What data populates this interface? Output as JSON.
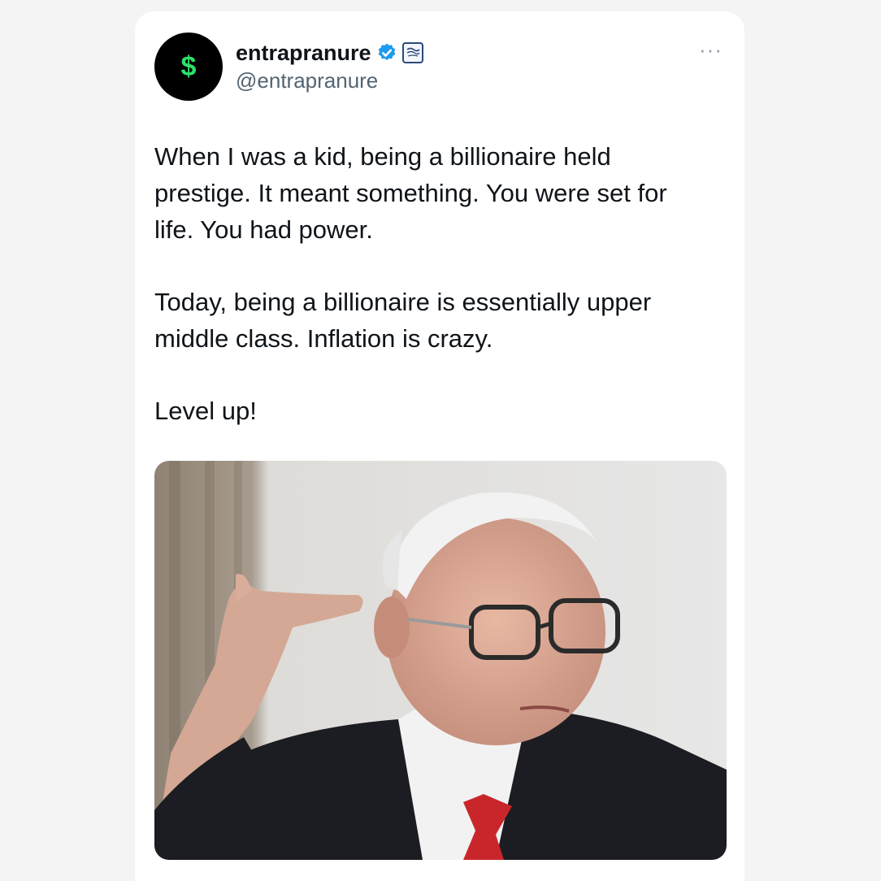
{
  "author": {
    "avatar_glyph": "$",
    "display_name": "entrapranure",
    "handle": "@entrapranure",
    "verified": true
  },
  "more_label": "···",
  "tweet": {
    "paragraphs": [
      "When I was a kid, being a billionaire held prestige. It meant something. You were set for life. You had power.",
      "Today, being a billionaire is essentially upper middle class. Inflation is crazy.",
      "Level up!"
    ]
  },
  "media": {
    "kind": "photo",
    "description_icon": "photo-of-elderly-man-saluting"
  },
  "colors": {
    "accent": "#1d9bf0",
    "avatar_dollar": "#2ee06e",
    "text": "#0f1419",
    "muted": "#536471"
  }
}
